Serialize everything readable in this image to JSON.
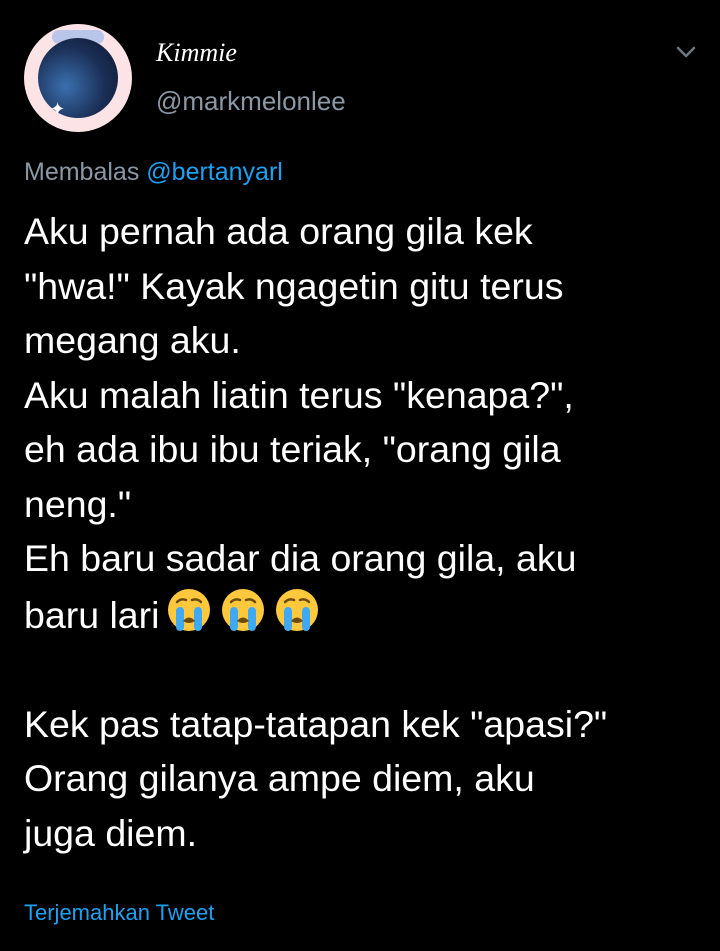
{
  "profile": {
    "display_name": "Kimmie",
    "handle": "@markmelonlee"
  },
  "reply": {
    "prefix": "Membalas",
    "mention": "@bertanyarl"
  },
  "tweet": {
    "line1": "Aku pernah ada orang gila kek",
    "line2": "\"hwa!\" Kayak ngagetin gitu terus",
    "line3": "megang aku.",
    "line4": "Aku malah liatin terus \"kenapa?\",",
    "line5": "eh ada ibu ibu teriak, \"orang gila",
    "line6": "neng.\"",
    "line7": "Eh baru sadar dia orang gila, aku",
    "line8": "baru lari",
    "line9": "Kek pas tatap-tatapan kek \"apasi?\"",
    "line10": "Orang gilanya ampe diem, aku",
    "line11": "juga diem.",
    "emoji": [
      "crying-face-emoji",
      "crying-face-emoji",
      "crying-face-emoji"
    ]
  },
  "actions": {
    "translate_label": "Terjemahkan Tweet"
  },
  "colors": {
    "background": "#000000",
    "text": "#ffffff",
    "muted": "#8b98a5",
    "link": "#1da1f2",
    "emoji": "#ffc83d"
  }
}
